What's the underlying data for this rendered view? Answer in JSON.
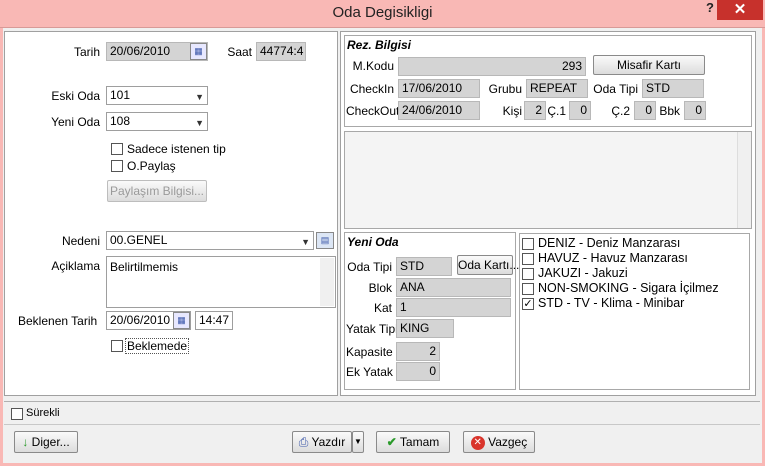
{
  "window": {
    "title": "Oda Degisikligi",
    "help": "?",
    "close": "✕"
  },
  "left": {
    "tarih_label": "Tarih",
    "tarih": "20/06/2010",
    "saat_label": "Saat",
    "saat": "44774:4",
    "eski_oda_label": "Eski Oda",
    "eski_oda": "101",
    "yeni_oda_label": "Yeni Oda",
    "yeni_oda": "108",
    "sadece_label": "Sadece istenen tip",
    "opaylas_label": "O.Paylaş",
    "paylasim_btn": "Paylaşım Bilgisi...",
    "nedeni_label": "Nedeni",
    "nedeni": "00.GENEL",
    "aciklama_label": "Açiklama",
    "aciklama": "Belirtilmemis",
    "beklenen_label": "Beklenen Tarih",
    "beklenen_tarih": "20/06/2010",
    "beklenen_saat": "14:47",
    "beklemede_label": "Beklemede"
  },
  "rez": {
    "title": "Rez. Bilgisi",
    "mkodu_label": "M.Kodu",
    "mkodu": "293",
    "misafir_btn": "Misafir Kartı",
    "checkin_label": "CheckIn",
    "checkin": "17/06/2010",
    "grubu_label": "Grubu",
    "grubu": "REPEAT",
    "odatipi_label": "Oda Tipi",
    "odatipi": "STD",
    "checkout_label": "CheckOut",
    "checkout": "24/06/2010",
    "kisi_label": "Kişi",
    "kisi": "2",
    "c1_label": "Ç.1",
    "c1": "0",
    "c2_label": "Ç.2",
    "c2": "0",
    "bbk_label": "Bbk",
    "bbk": "0"
  },
  "yeni": {
    "title": "Yeni Oda",
    "odatipi_label": "Oda Tipi",
    "odatipi": "STD",
    "odakarti_btn": "Oda Kartı...",
    "blok_label": "Blok",
    "blok": "ANA",
    "kat_label": "Kat",
    "kat": "1",
    "yatak_label": "Yatak Tipi",
    "yatak": "KING",
    "kapasite_label": "Kapasite",
    "kapasite": "2",
    "ekyatak_label": "Ek Yatak",
    "ekyatak": "0"
  },
  "amenities": [
    {
      "label": "DENIZ - Deniz Manzarası",
      "checked": false
    },
    {
      "label": "HAVUZ - Havuz Manzarası",
      "checked": false
    },
    {
      "label": "JAKUZI - Jakuzi",
      "checked": false
    },
    {
      "label": "NON-SMOKING - Sigara İçilmez",
      "checked": false
    },
    {
      "label": "STD - TV - Klima - Minibar",
      "checked": true
    }
  ],
  "footer": {
    "surekli_label": "Sürekli",
    "diger_btn": "Diger...",
    "yazdir_btn": "Yazdır",
    "tamam_btn": "Tamam",
    "vazgec_btn": "Vazgeç"
  },
  "icons": {
    "check_mark": "✓",
    "arrow_down": "▼"
  },
  "colors": {
    "titlebar": "#f9b8b5",
    "close": "#c7312c"
  }
}
